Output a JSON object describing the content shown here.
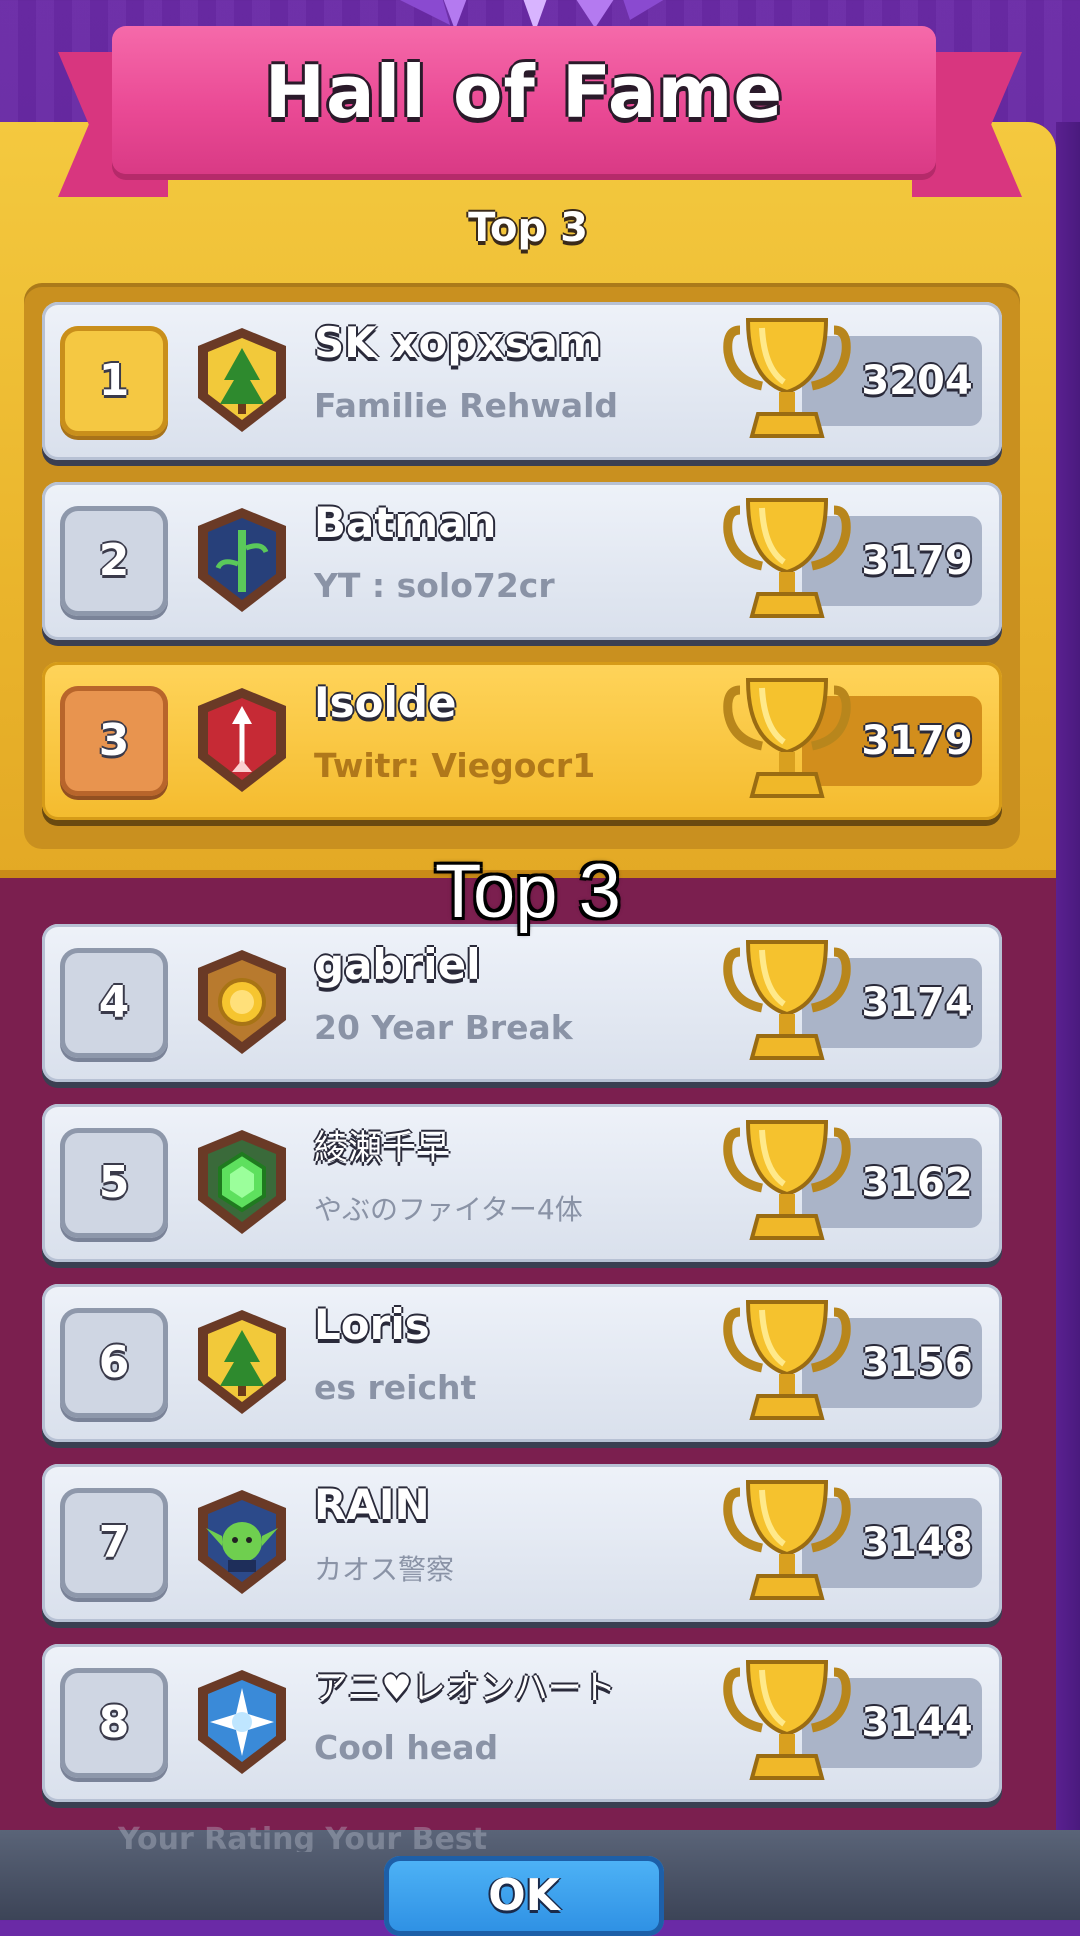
{
  "header": {
    "title": "Hall of Fame",
    "section_label": "Top 3",
    "overlay_caption": "Top 3"
  },
  "colors": {
    "ribbon": "#ea4a95",
    "gold_panel": "#f4c93f",
    "bottom_panel": "#7b1f4f",
    "row": "#e6ebf4",
    "ok_button": "#2d8fe3"
  },
  "leaderboard": [
    {
      "rank": "1",
      "name": "SK xopxsam",
      "clan": "Familie Rehwald",
      "score": "3204",
      "badge_icon": "tree-badge-icon"
    },
    {
      "rank": "2",
      "name": "Batman",
      "clan": "YT : solo72cr",
      "score": "3179",
      "badge_icon": "bamboo-badge-icon"
    },
    {
      "rank": "3",
      "name": "Isolde",
      "clan": "Twitr: Viegocr1",
      "score": "3179",
      "badge_icon": "arrow-badge-icon"
    },
    {
      "rank": "4",
      "name": "gabriel",
      "clan": "20 Year Break",
      "score": "3174",
      "badge_icon": "coin-badge-icon"
    },
    {
      "rank": "5",
      "name": "綾瀬千早",
      "clan": "やぶのファイター4体",
      "score": "3162",
      "badge_icon": "gem-badge-icon"
    },
    {
      "rank": "6",
      "name": "Loris",
      "clan": "es reicht",
      "score": "3156",
      "badge_icon": "tree-badge-icon"
    },
    {
      "rank": "7",
      "name": "RAIN",
      "clan": "カオス警察",
      "score": "3148",
      "badge_icon": "goblin-badge-icon"
    },
    {
      "rank": "8",
      "name": "アニ♥レオンハート",
      "clan": "Cool head",
      "score": "3144",
      "badge_icon": "star-badge-icon"
    }
  ],
  "footer": {
    "hint": "Your Rating     Your Best",
    "ok_label": "OK"
  }
}
